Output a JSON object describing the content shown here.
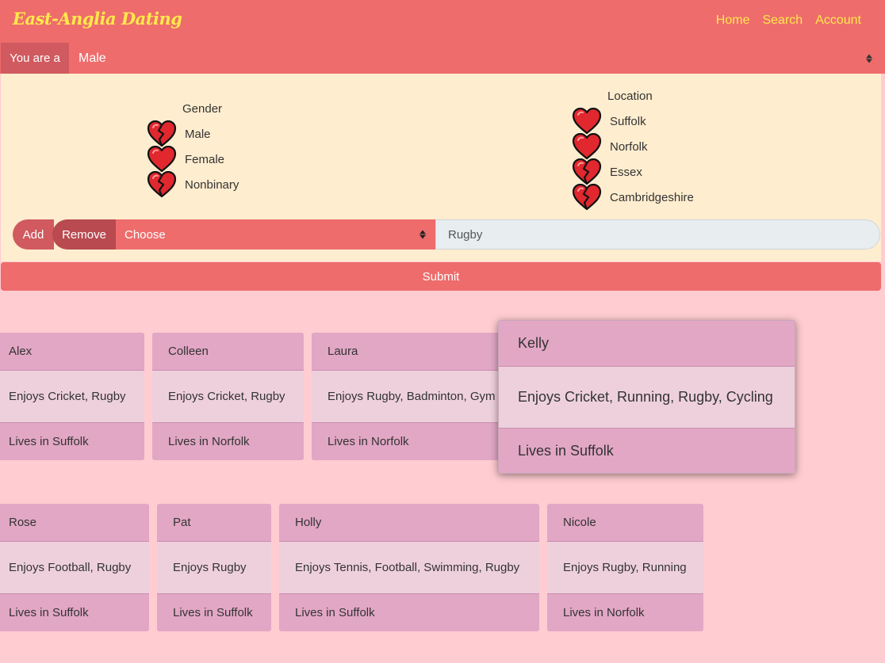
{
  "brand": "East-Anglia Dating",
  "nav": {
    "home": "Home",
    "search": "Search",
    "account": "Account"
  },
  "you_are": {
    "label": "You are a",
    "value": "Male"
  },
  "gender": {
    "title": "Gender",
    "options": [
      {
        "label": "Male",
        "icon": "broken-heart-icon"
      },
      {
        "label": "Female",
        "icon": "heart-icon"
      },
      {
        "label": "Nonbinary",
        "icon": "broken-heart-icon"
      }
    ]
  },
  "location": {
    "title": "Location",
    "options": [
      {
        "label": "Suffolk",
        "icon": "heart-icon"
      },
      {
        "label": "Norfolk",
        "icon": "heart-icon"
      },
      {
        "label": "Essex",
        "icon": "broken-heart-icon"
      },
      {
        "label": "Cambridgeshire",
        "icon": "broken-heart-icon"
      }
    ]
  },
  "controls": {
    "add": "Add",
    "remove": "Remove",
    "choose": "Choose",
    "input_value": "Rugby"
  },
  "submit": "Submit",
  "profiles": [
    {
      "name": "Alex",
      "enjoys": "Enjoys Cricket, Rugby",
      "lives": "Lives in Suffolk"
    },
    {
      "name": "Colleen",
      "enjoys": "Enjoys Cricket, Rugby",
      "lives": "Lives in Norfolk"
    },
    {
      "name": "Laura",
      "enjoys": "Enjoys Rugby, Badminton, Gym",
      "lives": "Lives in Norfolk"
    },
    {
      "name": "Kelly",
      "enjoys": "Enjoys Cricket, Running, Rugby, Cycling",
      "lives": "Lives in Suffolk"
    },
    {
      "name": "Rose",
      "enjoys": "Enjoys Football, Rugby",
      "lives": "Lives in Suffolk"
    },
    {
      "name": "Pat",
      "enjoys": "Enjoys Rugby",
      "lives": "Lives in Suffolk"
    },
    {
      "name": "Holly",
      "enjoys": "Enjoys Tennis, Football, Swimming, Rugby",
      "lives": "Lives in Suffolk"
    },
    {
      "name": "Nicole",
      "enjoys": "Enjoys Rugby, Running",
      "lives": "Lives in Norfolk"
    }
  ]
}
